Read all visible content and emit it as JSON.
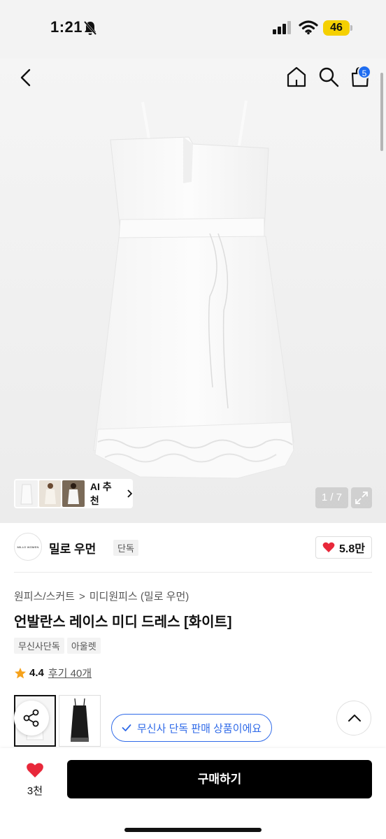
{
  "status": {
    "time": "1:21",
    "battery": "46",
    "icons": [
      "bell-off-icon",
      "signal-icon",
      "wifi-icon",
      "battery-icon"
    ]
  },
  "nav": {
    "icons": [
      "back-icon",
      "home-icon",
      "search-icon",
      "cart-icon"
    ],
    "cart_badge": "5"
  },
  "gallery": {
    "ai_label": "AI 추천",
    "pager": "1 / 7",
    "expand_icon": "expand-icon"
  },
  "brand": {
    "logo_text": "MILLO WOMEN",
    "name": "밀로 우먼",
    "tag": "단독",
    "likes": "5.8만"
  },
  "product": {
    "breadcrumb": [
      "원피스/스커트",
      "미디원피스 (밀로 우먼)"
    ],
    "title": "언발란스 레이스 미디 드레스 [화이트]",
    "tags": [
      "무신사단독",
      "아울렛"
    ],
    "rating": "4.4",
    "reviews": "후기 40개",
    "exclusive": "무신사 단독 판매 상품이에요"
  },
  "bottom": {
    "wish_count": "3천",
    "buy_label": "구매하기"
  },
  "colors": {
    "accent_blue": "#2f6ae8",
    "heart_red": "#e8283a",
    "star_orange": "#f6a21b",
    "battery_yellow": "#f5d000"
  }
}
